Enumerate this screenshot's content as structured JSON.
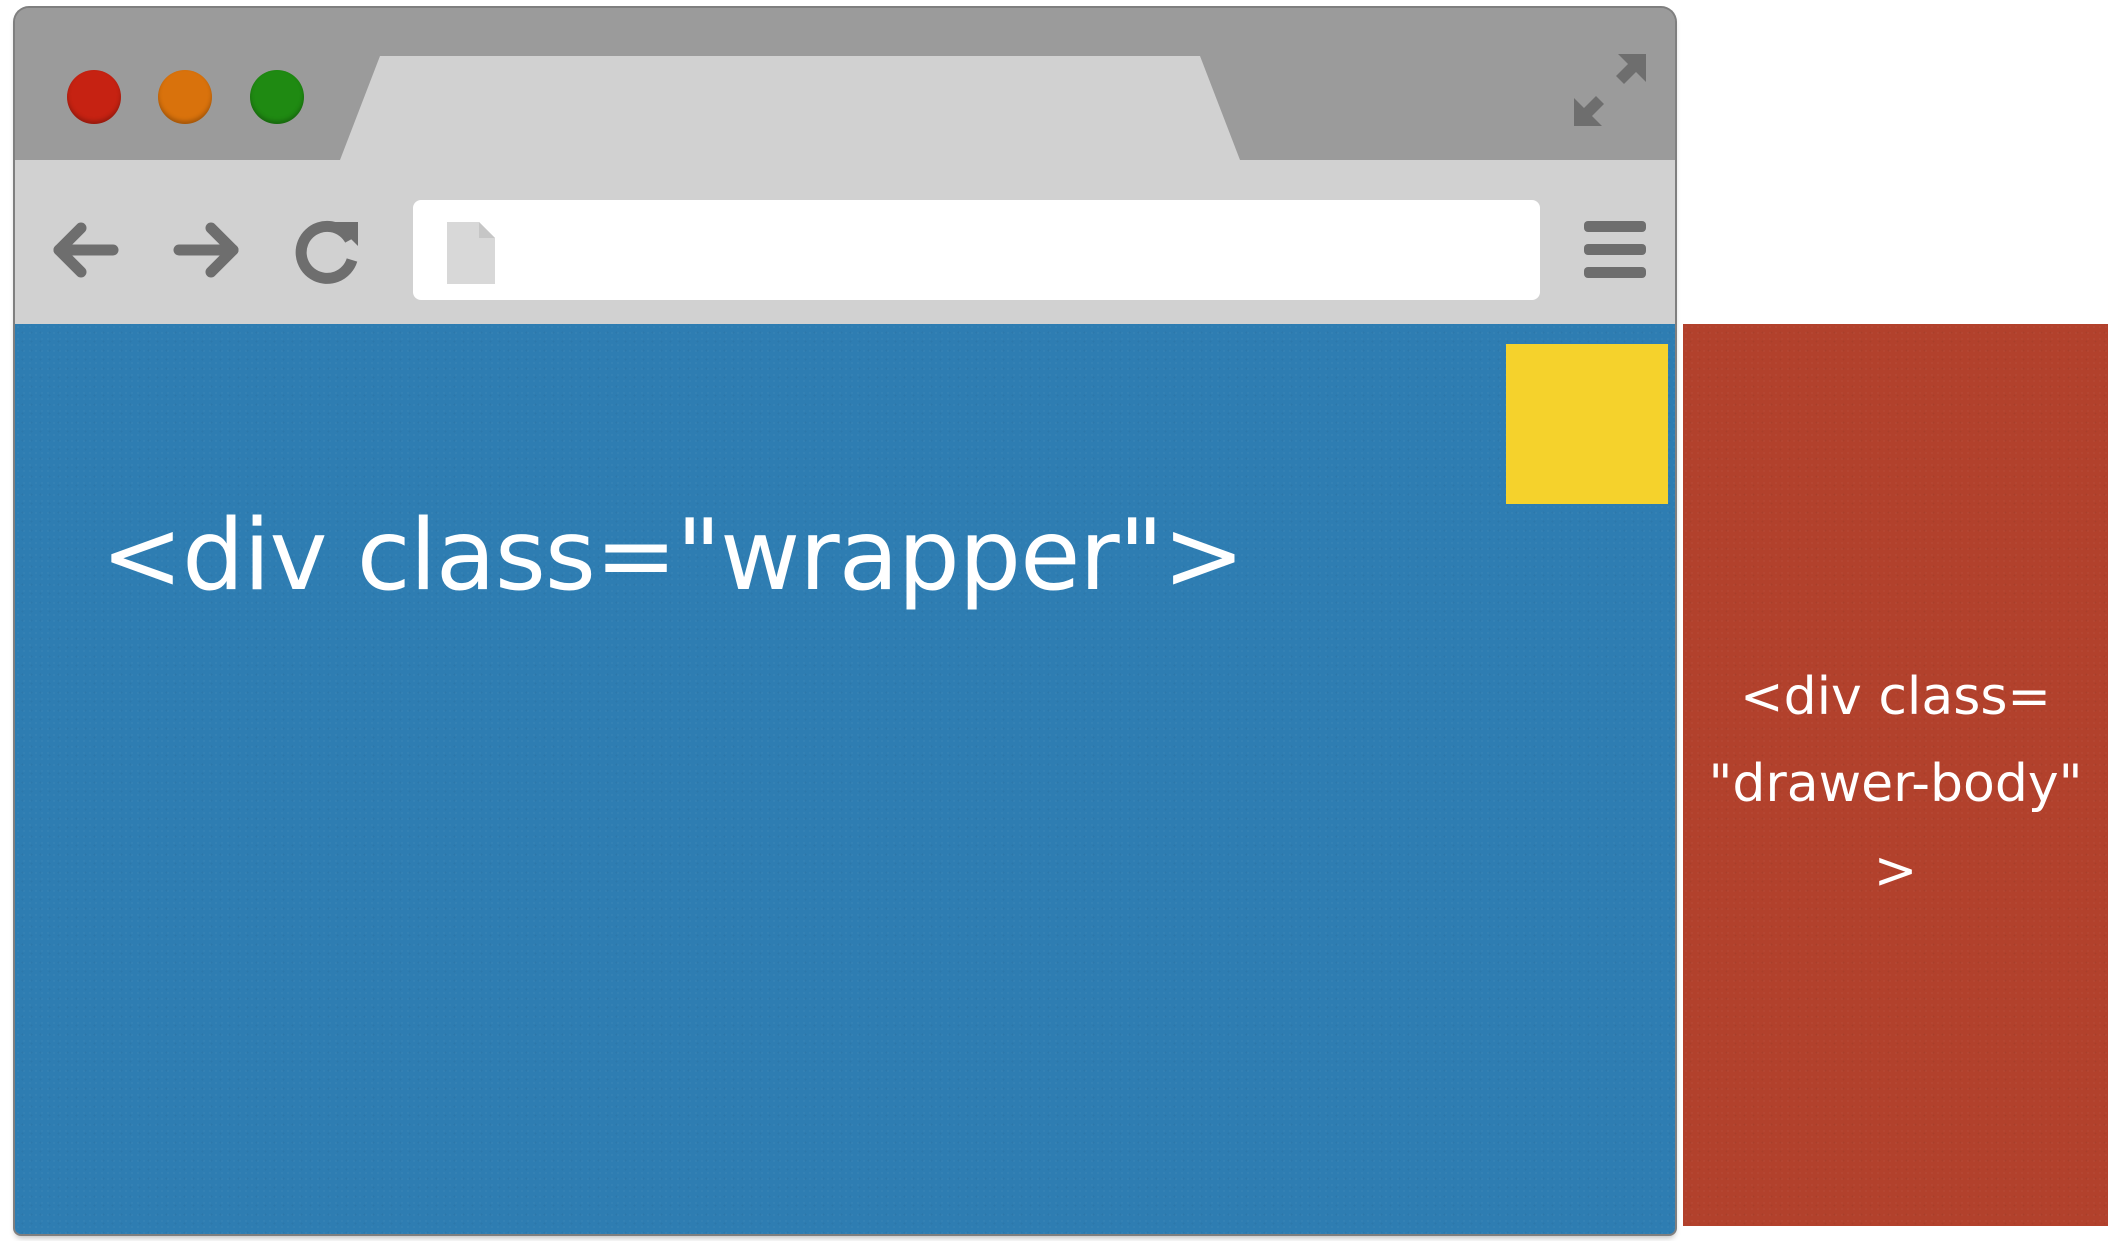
{
  "browser": {
    "address": {
      "value": "",
      "placeholder": ""
    },
    "icons": {
      "close": "close-button",
      "minimize": "minimize-button",
      "zoom": "zoom-button",
      "back": "back-arrow-icon",
      "forward": "forward-arrow-icon",
      "reload": "reload-icon",
      "page": "page-icon",
      "menu": "hamburger-menu-icon",
      "fullscreen": "fullscreen-icon"
    },
    "colors": {
      "frame": "#9b9b9b",
      "toolbar": "#d1d1d1",
      "traffic_red": "#c62212",
      "traffic_yellow": "#d9720c",
      "traffic_green": "#1f8a12"
    }
  },
  "wrapper": {
    "label": "<div class=\"wrapper\">",
    "color": "#2e7db2"
  },
  "toggle": {
    "color": "#f5d22c"
  },
  "drawer": {
    "lines": [
      "<div class=",
      "\"drawer-body\"",
      ">"
    ],
    "color": "#b2412c"
  }
}
